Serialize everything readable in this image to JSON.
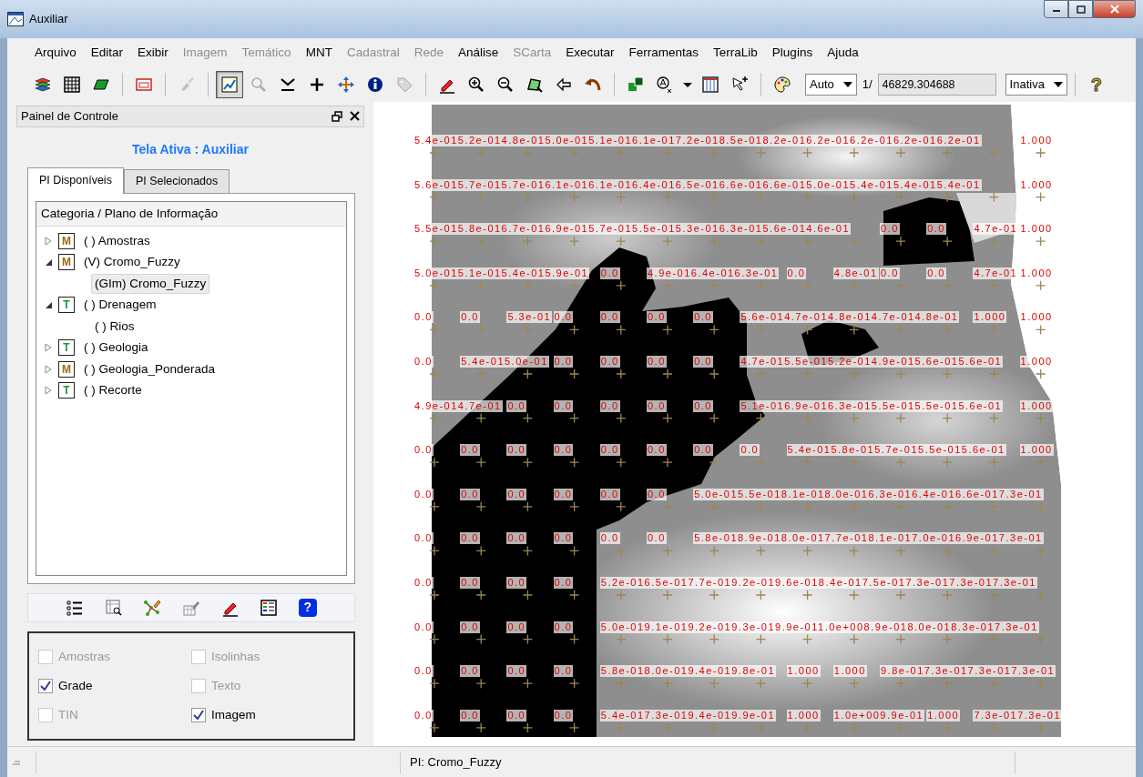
{
  "window": {
    "title": "Auxiliar"
  },
  "menu": [
    {
      "label": "Arquivo",
      "disabled": false
    },
    {
      "label": "Editar",
      "disabled": false
    },
    {
      "label": "Exibir",
      "disabled": false
    },
    {
      "label": "Imagem",
      "disabled": true
    },
    {
      "label": "Temático",
      "disabled": true
    },
    {
      "label": "MNT",
      "disabled": false
    },
    {
      "label": "Cadastral",
      "disabled": true
    },
    {
      "label": "Rede",
      "disabled": true
    },
    {
      "label": "Análise",
      "disabled": false
    },
    {
      "label": "SCarta",
      "disabled": true
    },
    {
      "label": "Executar",
      "disabled": false
    },
    {
      "label": "Ferramentas",
      "disabled": false
    },
    {
      "label": "TerraLib",
      "disabled": false
    },
    {
      "label": "Plugins",
      "disabled": false
    },
    {
      "label": "Ajuda",
      "disabled": false
    }
  ],
  "toolbar": {
    "buttons": [
      {
        "kind": "layers",
        "selected": false,
        "disabled": false
      },
      {
        "kind": "grid",
        "selected": false,
        "disabled": false
      },
      {
        "kind": "parallelogram",
        "selected": false,
        "disabled": false
      },
      {
        "kind": "separator"
      },
      {
        "kind": "window",
        "selected": false,
        "disabled": false
      },
      {
        "kind": "separator"
      },
      {
        "kind": "brush",
        "selected": false,
        "disabled": true
      },
      {
        "kind": "separator"
      },
      {
        "kind": "chart",
        "selected": true,
        "disabled": false
      },
      {
        "kind": "magnifier",
        "selected": false,
        "disabled": true
      },
      {
        "kind": "download",
        "selected": false,
        "disabled": false
      },
      {
        "kind": "plus",
        "selected": false,
        "disabled": false
      },
      {
        "kind": "move",
        "selected": false,
        "disabled": false
      },
      {
        "kind": "info",
        "selected": false,
        "disabled": false
      },
      {
        "kind": "tag",
        "selected": false,
        "disabled": true
      },
      {
        "kind": "separator"
      },
      {
        "kind": "pencil",
        "selected": false,
        "disabled": false
      },
      {
        "kind": "zoomin",
        "selected": false,
        "disabled": false
      },
      {
        "kind": "zoomout",
        "selected": false,
        "disabled": false
      },
      {
        "kind": "polygon",
        "selected": false,
        "disabled": false
      },
      {
        "kind": "back",
        "selected": false,
        "disabled": false
      },
      {
        "kind": "undo",
        "selected": false,
        "disabled": false
      },
      {
        "kind": "separator"
      },
      {
        "kind": "squares",
        "selected": false,
        "disabled": false
      },
      {
        "kind": "scale",
        "selected": false,
        "disabled": false
      },
      {
        "kind": "dropdown",
        "selected": false,
        "disabled": false
      },
      {
        "kind": "table",
        "selected": false,
        "disabled": false
      },
      {
        "kind": "pointer",
        "selected": false,
        "disabled": false
      },
      {
        "kind": "separator"
      },
      {
        "kind": "palette",
        "selected": false,
        "disabled": false
      }
    ],
    "scale_mode": "Auto",
    "scale_prefix": "1/",
    "scale_value": "46829.304688",
    "mode": "Inativa",
    "help_glyph": "?"
  },
  "control_panel": {
    "title": "Painel de Controle",
    "active_view": "Tela Ativa : Auxiliar",
    "tabs": [
      {
        "label": "PI Disponíveis",
        "selected": true
      },
      {
        "label": "PI Selecionados",
        "selected": false
      }
    ],
    "tree": {
      "header": "Categoria / Plano de Informação",
      "items": [
        {
          "badge": "M",
          "color": "#a06a0a",
          "label": "( ) Amostras",
          "expanded": false,
          "selected": false
        },
        {
          "badge": "M",
          "color": "#a06a0a",
          "label": "(V) Cromo_Fuzzy",
          "expanded": true,
          "selected": false,
          "children": [
            {
              "label": "(GIm) Cromo_Fuzzy",
              "selected": true
            }
          ]
        },
        {
          "badge": "T",
          "color": "#1a9a3a",
          "label": "( ) Drenagem",
          "expanded": true,
          "selected": false,
          "children": [
            {
              "label": "( ) Rios",
              "selected": false
            }
          ]
        },
        {
          "badge": "T",
          "color": "#1a9a3a",
          "label": "( ) Geologia",
          "expanded": false,
          "selected": false
        },
        {
          "badge": "M",
          "color": "#a06a0a",
          "label": "( ) Geologia_Ponderada",
          "expanded": false,
          "selected": false
        },
        {
          "badge": "T",
          "color": "#1a9a3a",
          "label": "( ) Recorte",
          "expanded": false,
          "selected": false
        }
      ]
    },
    "tools": [
      {
        "kind": "list"
      },
      {
        "kind": "tablezoom"
      },
      {
        "kind": "network"
      },
      {
        "kind": "tableedit"
      },
      {
        "kind": "pencil"
      },
      {
        "kind": "legend"
      },
      {
        "kind": "help",
        "glyph": "?"
      }
    ],
    "options": [
      {
        "label": "Amostras",
        "checked": false,
        "disabled": true
      },
      {
        "label": "Isolinhas",
        "checked": false,
        "disabled": true
      },
      {
        "label": "Grade",
        "checked": true,
        "disabled": false
      },
      {
        "label": "Texto",
        "checked": false,
        "disabled": true
      },
      {
        "label": "TIN",
        "checked": false,
        "disabled": true
      },
      {
        "label": "Imagem",
        "checked": true,
        "disabled": false
      }
    ]
  },
  "map": {
    "rows": [
      {
        "runs": [
          [
            "5.4e-01",
            "5.2e-01",
            "4.8e-01",
            "5.0e-01",
            "5.1e-01",
            "6.1e-01",
            "7.2e-01",
            "8.5e-01",
            "8.2e-01",
            "6.2e-01",
            "6.2e-01",
            "6.2e-01",
            "6.2e-01"
          ],
          [
            "1.000"
          ]
        ]
      },
      {
        "runs": [
          [
            "5.6e-01",
            "5.7e-01",
            "5.7e-01",
            "6.1e-01",
            "6.1e-01",
            "6.4e-01",
            "6.5e-01",
            "6.6e-01",
            "6.6e-01",
            "5.0e-01",
            "5.4e-01",
            "5.4e-01",
            "5.4e-01"
          ],
          [
            "1.000"
          ]
        ]
      },
      {
        "runs": [
          [
            "5.5e-01",
            "5.8e-01",
            "6.7e-01",
            "6.9e-01",
            "5.7e-01",
            "5.5e-01",
            "5.3e-01",
            "6.3e-01",
            "5.6e-01",
            "4.6e-01"
          ],
          [
            "0.0"
          ],
          [
            "0.0"
          ],
          [
            "4.7e-01"
          ],
          [
            "1.000"
          ]
        ]
      },
      {
        "runs": [
          [
            "5.0e-01",
            "5.1e-01",
            "5.4e-01",
            "5.9e-01"
          ],
          [
            "0.0"
          ],
          [
            "4.9e-01",
            "6.4e-01",
            "6.3e-01"
          ],
          [
            "0.0"
          ],
          [
            "4.8e-01"
          ],
          [
            "0.0"
          ],
          [
            "0.0"
          ],
          [
            "4.7e-01"
          ],
          [
            "1.000"
          ]
        ]
      },
      {
        "runs": [
          [
            "0.0"
          ],
          [
            "0.0"
          ],
          [
            "5.3e-01"
          ],
          [
            "0.0"
          ],
          [
            "0.0"
          ],
          [
            "0.0"
          ],
          [
            "0.0"
          ],
          [
            "5.6e-01",
            "4.7e-01",
            "4.8e-01",
            "4.7e-01",
            "4.8e-01"
          ],
          [
            "1.000"
          ],
          [
            "1.000"
          ]
        ]
      },
      {
        "runs": [
          [
            "0.0"
          ],
          [
            "5.4e-01",
            "5.0e-01"
          ],
          [
            "0.0"
          ],
          [
            "0.0"
          ],
          [
            "0.0"
          ],
          [
            "0.0"
          ],
          [
            "4.7e-01",
            "5.5e-01",
            "5.2e-01",
            "4.9e-01",
            "5.6e-01",
            "5.6e-01"
          ],
          [
            "1.000"
          ]
        ]
      },
      {
        "runs": [
          [
            "4.9e-01",
            "4.7e-01"
          ],
          [
            "0.0"
          ],
          [
            "0.0"
          ],
          [
            "0.0"
          ],
          [
            "0.0"
          ],
          [
            "0.0"
          ],
          [
            "5.1e-01",
            "6.9e-01",
            "6.3e-01",
            "5.5e-01",
            "5.5e-01",
            "5.6e-01"
          ],
          [
            "1.000"
          ]
        ]
      },
      {
        "runs": [
          [
            "0.0"
          ],
          [
            "0.0"
          ],
          [
            "0.0"
          ],
          [
            "0.0"
          ],
          [
            "0.0"
          ],
          [
            "0.0"
          ],
          [
            "0.0"
          ],
          [
            "0.0"
          ],
          [
            "5.4e-01",
            "5.8e-01",
            "5.7e-01",
            "5.5e-01",
            "5.6e-01"
          ],
          [
            "1.000"
          ]
        ]
      },
      {
        "runs": [
          [
            "0.0"
          ],
          [
            "0.0"
          ],
          [
            "0.0"
          ],
          [
            "0.0"
          ],
          [
            "0.0"
          ],
          [
            "0.0"
          ],
          [
            "5.0e-01",
            "5.5e-01",
            "8.1e-01",
            "8.0e-01",
            "6.3e-01",
            "6.4e-01",
            "6.6e-01",
            "7.3e-01"
          ]
        ]
      },
      {
        "runs": [
          [
            "0.0"
          ],
          [
            "0.0"
          ],
          [
            "0.0"
          ],
          [
            "0.0"
          ],
          [
            "0.0"
          ],
          [
            "0.0"
          ],
          [
            "5.8e-01",
            "8.9e-01",
            "8.0e-01",
            "7.7e-01",
            "8.1e-01",
            "7.0e-01",
            "6.9e-01",
            "7.3e-01"
          ]
        ]
      },
      {
        "runs": [
          [
            "0.0"
          ],
          [
            "0.0"
          ],
          [
            "0.0"
          ],
          [
            "0.0"
          ],
          [
            "5.2e-01",
            "6.5e-01",
            "7.7e-01",
            "9.2e-01",
            "9.6e-01",
            "8.4e-01",
            "7.5e-01",
            "7.3e-01",
            "7.3e-01",
            "7.3e-01"
          ]
        ]
      },
      {
        "runs": [
          [
            "0.0"
          ],
          [
            "0.0"
          ],
          [
            "0.0"
          ],
          [
            "0.0"
          ],
          [
            "5.0e-01",
            "9.1e-01",
            "9.2e-01",
            "9.3e-01",
            "9.9e-01",
            "1.0e+00",
            "8.9e-01",
            "8.0e-01",
            "8.3e-01",
            "7.3e-01"
          ]
        ]
      },
      {
        "runs": [
          [
            "0.0"
          ],
          [
            "0.0"
          ],
          [
            "0.0"
          ],
          [
            "0.0"
          ],
          [
            "5.8e-01",
            "8.0e-01",
            "9.4e-01",
            "9.8e-01"
          ],
          [
            "1.000"
          ],
          [
            "1.000"
          ],
          [
            "9.8e-01",
            "7.3e-01",
            "7.3e-01",
            "7.3e-01"
          ]
        ]
      },
      {
        "runs": [
          [
            "0.0"
          ],
          [
            "0.0"
          ],
          [
            "0.0"
          ],
          [
            "0.0"
          ],
          [
            "5.4e-01",
            "7.3e-01",
            "9.4e-01",
            "9.9e-01"
          ],
          [
            "1.000"
          ],
          [
            "1.0e+00",
            "9.9e-01"
          ],
          [
            "1.000"
          ],
          [
            "7.3e-01",
            "7.3e-01"
          ]
        ]
      }
    ]
  },
  "status_bar": {
    "text": "PI: Cromo_Fuzzy"
  }
}
